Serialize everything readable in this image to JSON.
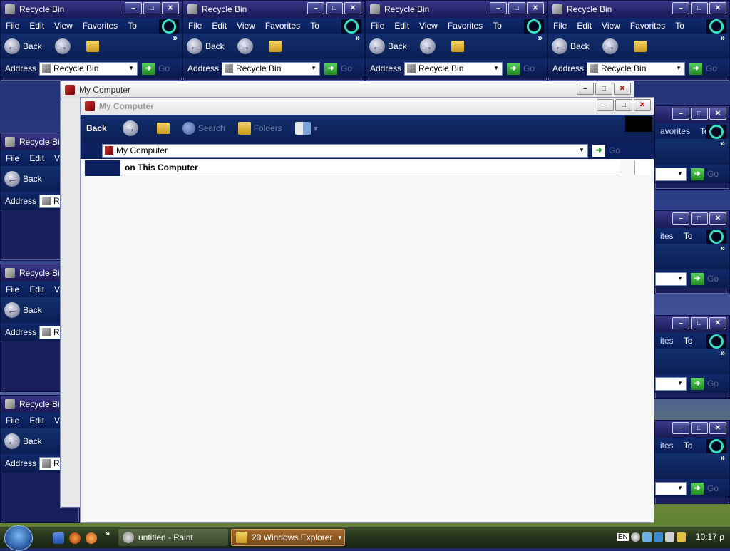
{
  "bg_windows": {
    "title": "Recycle Bin",
    "menu": [
      "File",
      "Edit",
      "View",
      "Favorites",
      "To"
    ],
    "menu_short": [
      "File",
      "Edit",
      "Vie"
    ],
    "back_label": "Back",
    "address_label": "Address",
    "address_value": "Recycle Bin",
    "address_short": "Re",
    "go_label": "Go",
    "partial_menu": [
      "avorites",
      "To"
    ],
    "partial_menu_right": [
      "ites",
      "To"
    ]
  },
  "mc_window": {
    "title": "My Computer"
  },
  "main_window": {
    "title": "My Computer",
    "back_label": "Back",
    "search_label": "Search",
    "folders_label": "Folders",
    "address_label": "Address",
    "address_value": "My Computer",
    "go_label": "Go",
    "section_header": "on This Computer"
  },
  "taskbar": {
    "tasks": [
      {
        "label": "untitled - Paint",
        "active": false
      },
      {
        "label": "20 Windows Explorer",
        "active": true
      }
    ],
    "language": "EN",
    "clock": "10:17 ρ"
  },
  "colors": {
    "accent": "#35e0c8",
    "titlebar": "#2a2870",
    "toolbar": "#12306e"
  }
}
